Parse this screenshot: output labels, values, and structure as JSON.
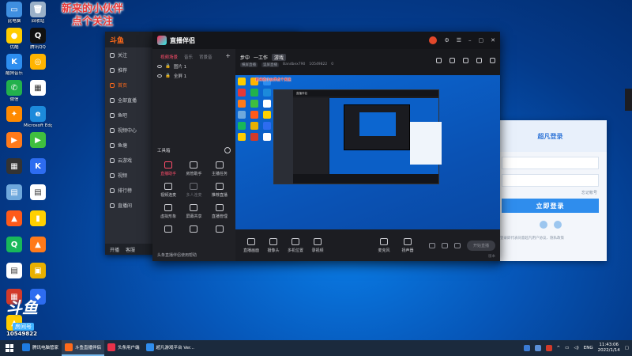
{
  "desktop": {
    "icons": [
      {
        "label": "此电脑",
        "color": "#3f8fe0",
        "glyph": "▭"
      },
      {
        "label": "回收站",
        "color": "#9ab0c8",
        "glyph": "🗑"
      },
      {
        "label": "优酷",
        "color": "#ffcc00",
        "glyph": "●"
      },
      {
        "label": "腾讯QQ",
        "color": "#111111",
        "glyph": "Q"
      },
      {
        "label": "酷狗音乐",
        "color": "#2d8ef0",
        "glyph": "K"
      },
      {
        "label": "",
        "color": "#ffb400",
        "glyph": "◎"
      },
      {
        "label": "微信",
        "color": "#22b14c",
        "glyph": "✆"
      },
      {
        "label": "",
        "color": "#ffffff",
        "glyph": "▦"
      },
      {
        "label": "",
        "color": "#ff8a00",
        "glyph": "✦"
      },
      {
        "label": "Microsoft Edge",
        "color": "#1c8adb",
        "glyph": "e"
      },
      {
        "label": "",
        "color": "#ff7a1a",
        "glyph": "▶"
      },
      {
        "label": "",
        "color": "#3fbf3f",
        "glyph": "▶"
      },
      {
        "label": "",
        "color": "#333333",
        "glyph": "▦"
      },
      {
        "label": "",
        "color": "#2d6cf0",
        "glyph": "K"
      },
      {
        "label": "",
        "color": "#6fa8dc",
        "glyph": "▤"
      },
      {
        "label": "",
        "color": "#ffffff",
        "glyph": "▤"
      },
      {
        "label": "",
        "color": "#ff5a1a",
        "glyph": "▲"
      },
      {
        "label": "",
        "color": "#ffd000",
        "glyph": "▮"
      },
      {
        "label": "",
        "color": "#18b85a",
        "glyph": "Q"
      },
      {
        "label": "",
        "color": "#ff7a1a",
        "glyph": "▲"
      },
      {
        "label": "",
        "color": "#ffffff",
        "glyph": "▤"
      },
      {
        "label": "",
        "color": "#e8b000",
        "glyph": "▣"
      },
      {
        "label": "",
        "color": "#d23a2a",
        "glyph": "▦"
      },
      {
        "label": "",
        "color": "#2d6cf0",
        "glyph": "◆"
      },
      {
        "label": "",
        "color": "#ffcc00",
        "glyph": "▲"
      }
    ]
  },
  "promo": {
    "line1": "新来的小伙伴",
    "line2": "点个关注"
  },
  "douyu": {
    "logo": "斗鱼",
    "side_items": [
      "关注",
      "推荐",
      "首页",
      "全部直播",
      "鱼吧",
      "视频中心",
      "鱼塘",
      "云游戏",
      "视频",
      "排行榜",
      "直播间"
    ],
    "footer": [
      "开播",
      "客服"
    ]
  },
  "login": {
    "title": "超凡登录",
    "forgot": "忘记帐号",
    "button": "立即登录",
    "agree": "登录即代表同意超凡用户协议、隐私政策"
  },
  "zhibo": {
    "app_name": "直播伴侣",
    "tabs": [
      "视频场景",
      "音乐",
      "背景音"
    ],
    "sources": [
      "图片 1",
      "全屏 1"
    ],
    "toolbox_title": "工具箱",
    "tools": [
      {
        "label": "直播助手",
        "state": "hot"
      },
      {
        "label": "房管助手",
        "state": "normal"
      },
      {
        "label": "主播任务",
        "state": "normal"
      },
      {
        "label": "视频连麦",
        "state": "normal"
      },
      {
        "label": "多人连麦",
        "state": "dim"
      },
      {
        "label": "推荐直播",
        "state": "normal"
      },
      {
        "label": "虚拟形象",
        "state": "normal"
      },
      {
        "label": "屏幕共享",
        "state": "normal"
      },
      {
        "label": "直播管理",
        "state": "normal"
      },
      {
        "label": "",
        "state": "normal"
      },
      {
        "label": "",
        "state": "normal"
      },
      {
        "label": "",
        "state": "normal"
      }
    ],
    "left_footer": "头条直播伴侣使用帮助",
    "room_title": "步中",
    "room_name": "一工作",
    "room_tag": "游戏",
    "room_chips": [
      "横屏直播",
      "竖屏直播"
    ],
    "room_meta_left": "Bandbex790",
    "room_meta_id": "10549822",
    "room_meta_likes": "0",
    "preview_overlay": "新来的小伙伴点个关注",
    "bottom_tools": [
      "直播画面",
      "摄像头",
      "多机位置",
      "录视频"
    ],
    "bottom_group": [
      "麦克风",
      "扬声器"
    ],
    "start_label": "开始直播",
    "version": "版本"
  },
  "badge": {
    "logo": "斗鱼",
    "name": "房间号",
    "room": "10549822"
  },
  "taskbar": {
    "tasks": [
      {
        "label": "腾讯电脑管家",
        "color": "#1e7be0",
        "active": false
      },
      {
        "label": "斗鱼直播伴侣",
        "color": "#ff6a1a",
        "active": true
      },
      {
        "label": "头条用户端",
        "color": "#e8324a",
        "active": false
      },
      {
        "label": "超凡游戏平台 Ver...",
        "color": "#2f8ded",
        "active": false
      }
    ],
    "lang": "ENG",
    "time": "11:43:06",
    "date": "2022/1/14"
  }
}
